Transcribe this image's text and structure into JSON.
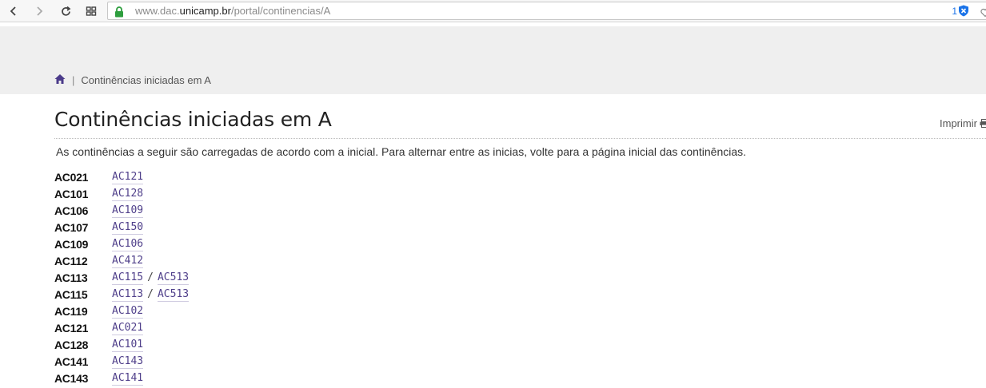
{
  "browser": {
    "url_prefix": "www.dac.",
    "url_domain": "unicamp.br",
    "url_path": "/portal/continencias/A",
    "extension_count": "1",
    "icons": [
      "back-icon",
      "forward-icon",
      "reload-icon",
      "speed-dial-icon",
      "lock-icon",
      "adblock-icon",
      "heart-icon"
    ]
  },
  "breadcrumb": {
    "separator": "|",
    "current": "Continências iniciadas em A"
  },
  "page": {
    "title": "Continências iniciadas em A",
    "print_label": "Imprimir",
    "intro": "As continências a seguir são carregadas de acordo com a inicial. Para alternar entre as inicias, volte para a página inicial das continências."
  },
  "rows": [
    {
      "code": "AC021",
      "equivalents": [
        "AC121"
      ]
    },
    {
      "code": "AC101",
      "equivalents": [
        "AC128"
      ]
    },
    {
      "code": "AC106",
      "equivalents": [
        "AC109"
      ]
    },
    {
      "code": "AC107",
      "equivalents": [
        "AC150"
      ]
    },
    {
      "code": "AC109",
      "equivalents": [
        "AC106"
      ]
    },
    {
      "code": "AC112",
      "equivalents": [
        "AC412"
      ]
    },
    {
      "code": "AC113",
      "equivalents": [
        "AC115",
        "AC513"
      ]
    },
    {
      "code": "AC115",
      "equivalents": [
        "AC113",
        "AC513"
      ]
    },
    {
      "code": "AC119",
      "equivalents": [
        "AC102"
      ]
    },
    {
      "code": "AC121",
      "equivalents": [
        "AC021"
      ]
    },
    {
      "code": "AC128",
      "equivalents": [
        "AC101"
      ]
    },
    {
      "code": "AC141",
      "equivalents": [
        "AC143"
      ]
    },
    {
      "code": "AC143",
      "equivalents": [
        "AC141"
      ]
    }
  ],
  "colors": {
    "link": "#4f3f8a",
    "header_band": "#efefef",
    "home_icon": "#4b3b8a",
    "lock": "#2e9e3e"
  }
}
